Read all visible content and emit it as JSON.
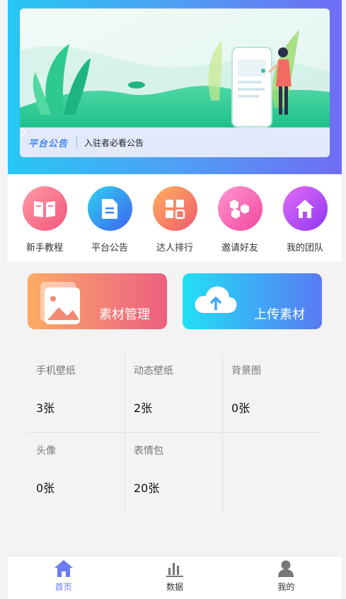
{
  "banner": {
    "notice_tag": "平台公告",
    "notice_text": "入驻者必看公告"
  },
  "menu": [
    {
      "label": "新手教程",
      "icon": "book-icon",
      "color_from": "#ff9aa6",
      "color_to": "#f3567a"
    },
    {
      "label": "平台公告",
      "icon": "document-icon",
      "color_from": "#2fd2ee",
      "color_to": "#3d63f2"
    },
    {
      "label": "达人排行",
      "icon": "grid-icon",
      "color_from": "#ffb15e",
      "color_to": "#f25a6e"
    },
    {
      "label": "邀请好友",
      "icon": "hexagon-icon",
      "color_from": "#ff96d0",
      "color_to": "#f2479e"
    },
    {
      "label": "我的团队",
      "icon": "home-icon",
      "color_from": "#e36cf6",
      "color_to": "#8e36f1"
    }
  ],
  "cards": {
    "left_label": "素材管理",
    "right_label": "上传素材"
  },
  "stats": [
    {
      "title": "手机壁纸",
      "value": "3张"
    },
    {
      "title": "动态壁纸",
      "value": "2张"
    },
    {
      "title": "背景图",
      "value": "0张"
    },
    {
      "title": "头像",
      "value": "0张"
    },
    {
      "title": "表情包",
      "value": "20张"
    }
  ],
  "tabbar": {
    "active_color": "#6a7bf3",
    "tabs": [
      {
        "label": "首页",
        "icon": "home-icon"
      },
      {
        "label": "数据",
        "icon": "bar-chart-icon"
      },
      {
        "label": "我的",
        "icon": "user-icon"
      }
    ]
  }
}
